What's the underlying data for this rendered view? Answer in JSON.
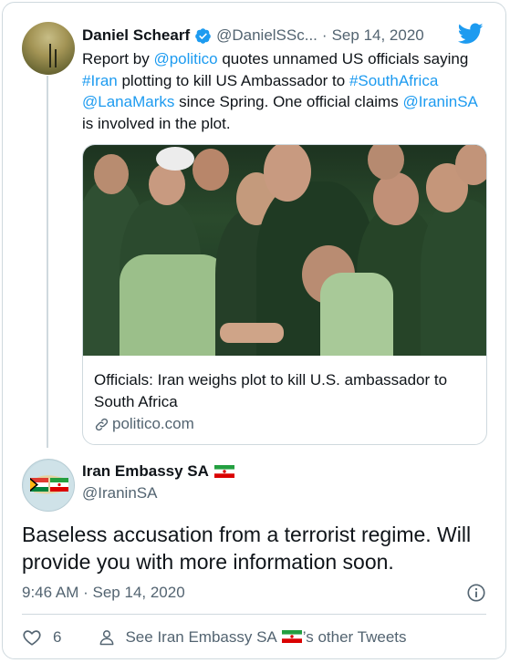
{
  "quoted_tweet": {
    "author_name": "Daniel Schearf",
    "author_handle": "@DanielSSc...",
    "separator": "·",
    "date": "Sep 14, 2020",
    "text_parts": [
      "Report by ",
      "@politico",
      " quotes unnamed US officials saying ",
      "#Iran",
      " plotting to kill US Ambassador to ",
      "#SouthAfrica",
      " ",
      "@LanaMarks",
      " since Spring.  One official claims ",
      "@IraninSA",
      " is involved in the plot."
    ],
    "link_card": {
      "title": "Officials: Iran weighs plot to kill U.S. ambassador to South Africa",
      "domain": "politico.com"
    }
  },
  "tweet": {
    "author_name": "Iran Embassy SA",
    "author_handle": "@IraninSA",
    "text": "Baseless accusation from a terrorist regime. Will provide you with more information soon.",
    "time": "9:46 AM",
    "separator": "·",
    "date": "Sep 14, 2020",
    "like_count": "6",
    "see_more_prefix": "See Iran Embassy SA",
    "see_more_suffix": "’s other Tweets"
  },
  "icons": {
    "verified": "verified-badge-icon",
    "bird": "twitter-bird-icon",
    "link": "link-icon",
    "info": "info-icon",
    "heart": "heart-icon",
    "person": "person-icon",
    "flag": "iran-flag-icon"
  },
  "colors": {
    "accent": "#1d9bf0",
    "text": "#0f1419",
    "secondary": "#536471",
    "border": "#cfd9de"
  }
}
